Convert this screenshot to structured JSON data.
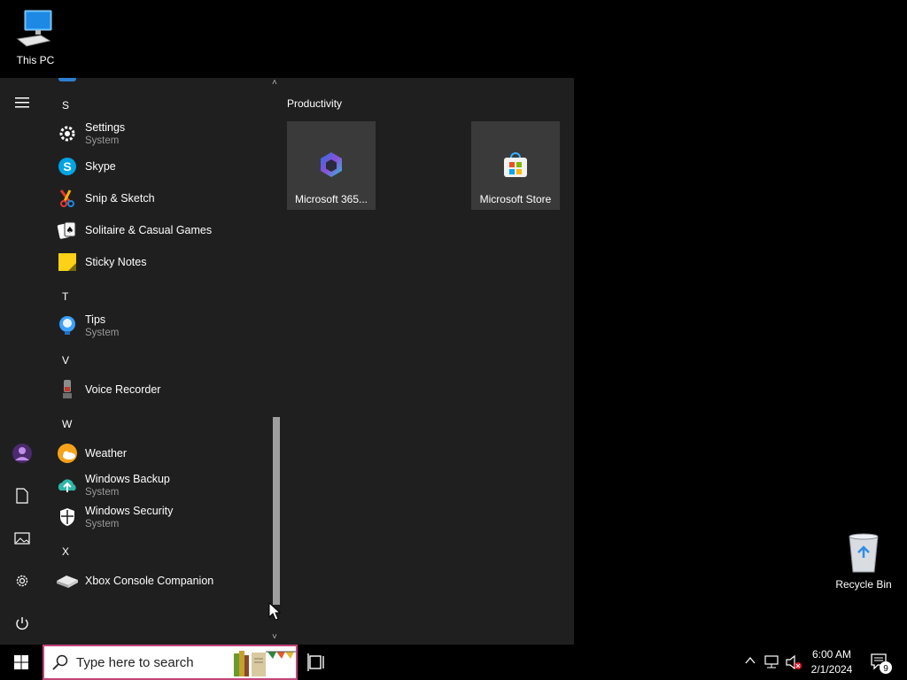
{
  "desktop": {
    "this_pc_label": "This PC",
    "recycle_bin_label": "Recycle Bin"
  },
  "start_menu": {
    "rail": {
      "icons": [
        "hamburger-icon",
        "user-avatar",
        "documents-icon",
        "pictures-icon",
        "settings-icon",
        "power-icon"
      ]
    },
    "app_list": [
      {
        "type": "letter",
        "label": "S"
      },
      {
        "type": "app",
        "name": "Settings",
        "sub": "System",
        "icon": "settings-gear-icon"
      },
      {
        "type": "app",
        "name": "Skype",
        "sub": "",
        "icon": "skype-icon"
      },
      {
        "type": "app",
        "name": "Snip & Sketch",
        "sub": "",
        "icon": "snip-sketch-icon"
      },
      {
        "type": "app",
        "name": "Solitaire & Casual Games",
        "sub": "",
        "icon": "solitaire-icon"
      },
      {
        "type": "app",
        "name": "Sticky Notes",
        "sub": "",
        "icon": "sticky-notes-icon"
      },
      {
        "type": "letter",
        "label": "T"
      },
      {
        "type": "app",
        "name": "Tips",
        "sub": "System",
        "icon": "tips-lightbulb-icon"
      },
      {
        "type": "letter",
        "label": "V"
      },
      {
        "type": "app",
        "name": "Voice Recorder",
        "sub": "",
        "icon": "voice-recorder-icon"
      },
      {
        "type": "letter",
        "label": "W"
      },
      {
        "type": "app",
        "name": "Weather",
        "sub": "",
        "icon": "weather-icon"
      },
      {
        "type": "app",
        "name": "Windows Backup",
        "sub": "System",
        "icon": "windows-backup-icon"
      },
      {
        "type": "app",
        "name": "Windows Security",
        "sub": "System",
        "icon": "windows-security-shield-icon"
      },
      {
        "type": "letter",
        "label": "X"
      },
      {
        "type": "app",
        "name": "Xbox Console Companion",
        "sub": "",
        "icon": "xbox-companion-icon"
      }
    ],
    "tiles": {
      "group_title": "Productivity",
      "items": [
        {
          "label": "Microsoft 365...",
          "icon": "microsoft-365-icon"
        },
        {
          "label": "Microsoft Store",
          "icon": "microsoft-store-icon"
        }
      ]
    }
  },
  "taskbar": {
    "search_placeholder": "Type here to search",
    "clock_time": "6:00 AM",
    "clock_date": "2/1/2024",
    "notification_count": "9"
  },
  "colors": {
    "start_bg": "#1f1f1f",
    "tile_bg": "#3a3a3a",
    "search_border": "#c3457a"
  }
}
